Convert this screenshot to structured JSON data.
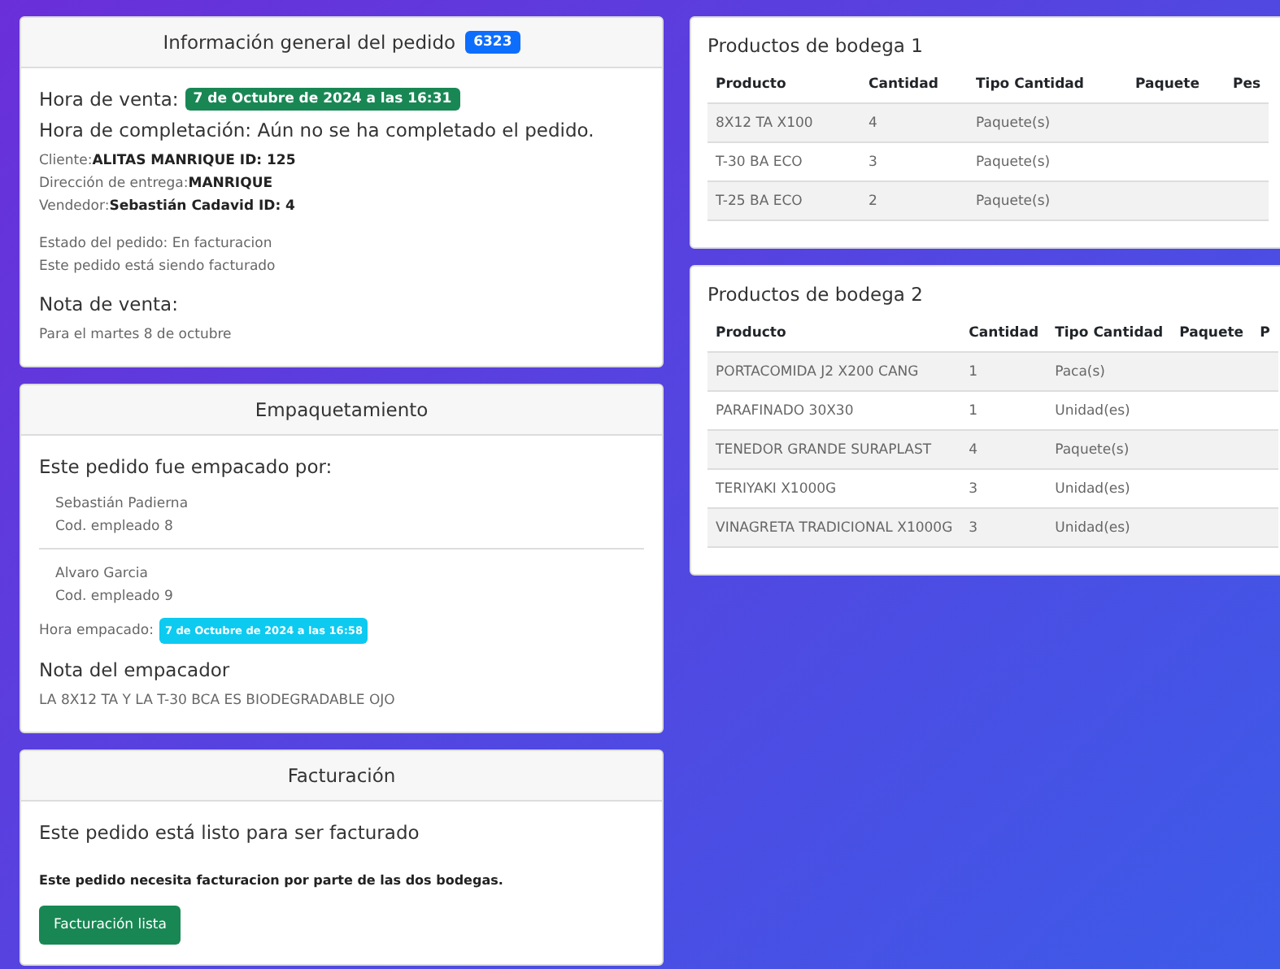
{
  "general": {
    "title": "Información general del pedido",
    "order_number": "6323",
    "sale_time_label": "Hora de venta:",
    "sale_time": "7 de Octubre de 2024 a las 16:31",
    "completion": "Hora de completación: Aún no se ha completado el pedido.",
    "details": [
      {
        "label": "Cliente:",
        "value": "ALITAS MANRIQUE ID: 125"
      },
      {
        "label": "Dirección de entrega:",
        "value": "MANRIQUE"
      },
      {
        "label": "Vendedor:",
        "value": "Sebastián Cadavid ID: 4"
      }
    ],
    "status": "Estado del pedido: En facturacion",
    "status_note": "Este pedido está siendo facturado",
    "note_title": "Nota de venta:",
    "note": "Para el martes 8 de octubre"
  },
  "packing": {
    "title": "Empaquetamiento",
    "packed_by": "Este pedido fue empacado por:",
    "packers": [
      {
        "name": "Sebastián Padierna",
        "code": "Cod. empleado 8"
      },
      {
        "name": "Alvaro Garcia",
        "code": "Cod. empleado 9"
      }
    ],
    "time_label": "Hora empacado:",
    "time": "7 de Octubre de 2024 a las 16:58",
    "note_title": "Nota del empacador",
    "note": "LA 8X12 TA Y LA T-30 BCA ES BIODEGRADABLE OJO"
  },
  "billing": {
    "title": "Facturación",
    "ready": "Este pedido está listo para ser facturado",
    "requirement": "Este pedido necesita facturacion por parte de las dos bodegas.",
    "button": "Facturación lista"
  },
  "warehouses": [
    {
      "title": "Productos de bodega 1",
      "columns": [
        "Producto",
        "Cantidad",
        "Tipo Cantidad",
        "Paquete",
        "Pes"
      ],
      "rows": [
        [
          "8X12 TA X100",
          "4",
          "Paquete(s)"
        ],
        [
          "T-30 BA ECO",
          "3",
          "Paquete(s)"
        ],
        [
          "T-25 BA ECO",
          "2",
          "Paquete(s)"
        ]
      ]
    },
    {
      "title": "Productos de bodega 2",
      "columns": [
        "Producto",
        "Cantidad",
        "Tipo Cantidad",
        "Paquete",
        "P"
      ],
      "rows": [
        [
          "PORTACOMIDA J2 X200 CANG",
          "1",
          "Paca(s)"
        ],
        [
          "PARAFINADO 30X30",
          "1",
          "Unidad(es)"
        ],
        [
          "TENEDOR GRANDE SURAPLAST",
          "4",
          "Paquete(s)"
        ],
        [
          "TERIYAKI X1000G",
          "3",
          "Unidad(es)"
        ],
        [
          "VINAGRETA TRADICIONAL X1000G",
          "3",
          "Unidad(es)"
        ]
      ]
    }
  ]
}
